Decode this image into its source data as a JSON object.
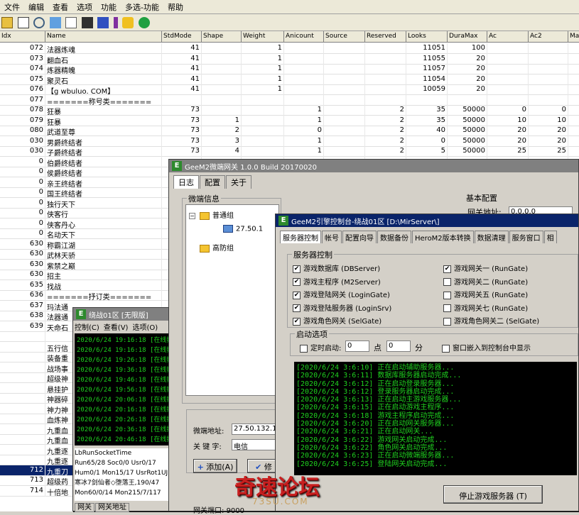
{
  "menubar": [
    "文件",
    "编辑",
    "查看",
    "选项",
    "功能",
    "多选-功能",
    "帮助"
  ],
  "grid": {
    "columns": [
      "Idx",
      "Name",
      "StdMode",
      "Shape",
      "Weight",
      "Anicount",
      "Source",
      "Reserved",
      "Looks",
      "DuraMax",
      "Ac",
      "Ac2",
      "Ma"
    ],
    "rows": [
      [
        "072",
        "法器炼魂",
        "41",
        "",
        "1",
        "",
        "",
        "",
        "11051",
        "100",
        "",
        "",
        ""
      ],
      [
        "073",
        "翻血石",
        "41",
        "",
        "1",
        "",
        "",
        "",
        "11055",
        "20",
        "",
        "",
        ""
      ],
      [
        "074",
        "炼器精魄",
        "41",
        "",
        "1",
        "",
        "",
        "",
        "11057",
        "20",
        "",
        "",
        ""
      ],
      [
        "075",
        "聚灵石",
        "41",
        "",
        "1",
        "",
        "",
        "",
        "11054",
        "20",
        "",
        "",
        ""
      ],
      [
        "076",
        "【g wbuluo. COM】",
        "41",
        "",
        "1",
        "",
        "",
        "",
        "10059",
        "20",
        "",
        "",
        ""
      ],
      [
        "077",
        "=======称号类=======",
        "",
        "",
        "",
        "",
        "",
        "",
        "",
        "",
        "",
        "",
        ""
      ],
      [
        "078",
        "狂暴",
        "73",
        "",
        "",
        "1",
        "",
        "2",
        "35",
        "50000",
        "0",
        "0",
        ""
      ],
      [
        "079",
        "狂暴",
        "73",
        "1",
        "",
        "1",
        "",
        "2",
        "35",
        "50000",
        "10",
        "10",
        ""
      ],
      [
        "080",
        "武道至尊",
        "73",
        "2",
        "",
        "0",
        "",
        "2",
        "40",
        "50000",
        "20",
        "20",
        ""
      ],
      [
        "030",
        "男爵终结者",
        "73",
        "3",
        "",
        "1",
        "",
        "2",
        "0",
        "50000",
        "20",
        "20",
        ""
      ],
      [
        "030",
        "子爵终结者",
        "73",
        "4",
        "",
        "1",
        "",
        "2",
        "5",
        "50000",
        "25",
        "25",
        ""
      ],
      [
        "0",
        "伯爵终结者",
        "",
        "",
        "",
        "",
        "",
        "",
        "",
        "",
        "",
        "",
        ""
      ],
      [
        "0",
        "侯爵终结者",
        "",
        "",
        "",
        "",
        "",
        "",
        "",
        "",
        "",
        "",
        ""
      ],
      [
        "0",
        "亲王终结者",
        "",
        "",
        "",
        "",
        "",
        "",
        "",
        "",
        "",
        "",
        ""
      ],
      [
        "0",
        "国王终结者",
        "",
        "",
        "",
        "",
        "",
        "",
        "",
        "",
        "",
        "",
        ""
      ],
      [
        "0",
        "独行天下",
        "",
        "",
        "",
        "",
        "",
        "",
        "",
        "",
        "",
        "",
        ""
      ],
      [
        "0",
        "侠客行",
        "",
        "",
        "",
        "",
        "",
        "",
        "",
        "",
        "",
        "",
        ""
      ],
      [
        "0",
        "侠客丹心",
        "",
        "",
        "",
        "",
        "",
        "",
        "",
        "",
        "",
        "",
        ""
      ],
      [
        "0",
        "名动天下",
        "",
        "",
        "",
        "",
        "",
        "",
        "",
        "",
        "",
        "",
        ""
      ],
      [
        "630",
        "称霸江湖",
        "",
        "",
        "",
        "",
        "",
        "",
        "",
        "",
        "",
        "",
        ""
      ],
      [
        "630",
        "武林天骄",
        "",
        "",
        "",
        "",
        "",
        "",
        "",
        "",
        "",
        "",
        ""
      ],
      [
        "630",
        "紫禁之巅",
        "",
        "",
        "",
        "",
        "",
        "",
        "",
        "",
        "",
        "",
        ""
      ],
      [
        "630",
        "招主",
        "",
        "",
        "",
        "",
        "",
        "",
        "",
        "",
        "",
        "",
        ""
      ],
      [
        "635",
        "找战",
        "",
        "",
        "",
        "",
        "",
        "",
        "",
        "",
        "",
        "",
        ""
      ],
      [
        "636",
        "=======抒订类=======",
        "",
        "",
        "",
        "",
        "",
        "",
        "",
        "",
        "",
        "",
        ""
      ],
      [
        "637",
        "玛法通",
        "",
        "",
        "",
        "",
        "",
        "",
        "",
        "",
        "",
        "",
        ""
      ],
      [
        "638",
        "法器通",
        "",
        "",
        "",
        "",
        "",
        "",
        "",
        "",
        "",
        "",
        ""
      ],
      [
        "639",
        "天命石",
        "",
        "",
        "",
        "",
        "",
        "",
        "",
        "",
        "",
        "",
        ""
      ],
      [
        "",
        "",
        "",
        "",
        "",
        "",
        "",
        "",
        "",
        "",
        "",
        "",
        ""
      ],
      [
        "",
        "五行信",
        "",
        "",
        "",
        "",
        "",
        "",
        "",
        "",
        "",
        "",
        ""
      ],
      [
        "",
        "装备重",
        "",
        "",
        "",
        "",
        "",
        "",
        "",
        "",
        "",
        "",
        ""
      ],
      [
        "",
        "战场事",
        "",
        "",
        "",
        "",
        "",
        "",
        "",
        "",
        "",
        "",
        ""
      ],
      [
        "",
        "超级神",
        "",
        "",
        "",
        "",
        "",
        "",
        "",
        "",
        "",
        "",
        ""
      ],
      [
        "",
        "悬挂护",
        "",
        "",
        "",
        "",
        "",
        "",
        "",
        "",
        "",
        "",
        ""
      ],
      [
        "",
        "神器碎",
        "",
        "",
        "",
        "",
        "",
        "",
        "",
        "",
        "",
        "",
        ""
      ],
      [
        "",
        "神力神",
        "",
        "",
        "",
        "",
        "",
        "",
        "",
        "",
        "",
        "",
        ""
      ],
      [
        "",
        "血炼神",
        "",
        "",
        "",
        "",
        "",
        "",
        "",
        "",
        "",
        "",
        ""
      ],
      [
        "",
        "九重血",
        "",
        "",
        "",
        "",
        "",
        "",
        "",
        "",
        "",
        "",
        ""
      ],
      [
        "",
        "九重血",
        "",
        "",
        "",
        "",
        "",
        "",
        "",
        "",
        "",
        "",
        ""
      ],
      [
        "",
        "九重逐",
        "",
        "",
        "",
        "",
        "",
        "",
        "",
        "",
        "",
        "",
        ""
      ],
      [
        "",
        "九重逐",
        "",
        "",
        "",
        "",
        "",
        "",
        "",
        "",
        "",
        "",
        ""
      ],
      [
        "712",
        "九重刀",
        "",
        "",
        "",
        "",
        "",
        "",
        "",
        "",
        "",
        "",
        ""
      ],
      [
        "713",
        "超级药",
        "",
        "",
        "",
        "",
        "",
        "",
        "",
        "",
        "",
        "",
        ""
      ],
      [
        "714",
        "十倍地",
        "",
        "",
        "",
        "",
        "",
        "",
        "",
        "",
        "",
        "",
        ""
      ]
    ]
  },
  "gateway_window": {
    "title": "GeeM2微端网关 1.0.0 Build 20170020",
    "tabs": [
      "日志",
      "配置",
      "关于"
    ],
    "group_label": "微端信息",
    "tree": [
      {
        "label": "普通组",
        "type": "folder"
      },
      {
        "label": "27.50.1",
        "type": "monitor"
      },
      {
        "label": "高防组",
        "type": "folder"
      }
    ],
    "basic_config": "基本配置",
    "gateway_address_label": "网关地址:",
    "gateway_address_value": "0.0.0.0",
    "micro_address_label": "微端地址:",
    "micro_address_value": "27.50.132.1",
    "keyword_label": "关 键 字:",
    "keyword_value": "电信",
    "add_button": "添加(A)",
    "modify_button": "修",
    "gateway_port_label": "网关端口:",
    "gateway_port_value": "9000"
  },
  "small_window": {
    "title": "绕战01区 [无限版]",
    "menu": [
      "控制(C)",
      "查看(V)",
      "选项(O)"
    ],
    "log": [
      "2020/6/24 19:16:18 [在线数",
      "2020/6/24 19:16:18 [在线数",
      "2020/6/24 19:26:18 [在线数",
      "2020/6/24 19:36:18 [在线数",
      "2020/6/24 19:46:18 [在线数",
      "2020/6/24 19:56:18 [在线数",
      "2020/6/24 20:06:18 [在线数",
      "2020/6/24 20:16:18 [在线数",
      "2020/6/24 20:26:18 [在线数",
      "2020/6/24 20:36:18 [在线数",
      "2020/6/24 20:46:18 [在线数"
    ],
    "status": [
      "LbRunSocketTime",
      "Run65/28 Soc0/0 Usr0/17",
      "Hum0/1 Mon15/17 UsrRot1UJ",
      "寒冰7剑仙者◇堕落王,190/47",
      "Mon60/0/14 Mon215/7/117"
    ],
    "bottom_tabs": [
      "网关",
      "网关地址"
    ]
  },
  "console_window": {
    "title": "GeeM2引擎控制台-绕战01区 [D:\\MirServer\\]",
    "tabs": [
      "服务器控制",
      "帐号",
      "配置向导",
      "数据备份",
      "HeroM2版本转换",
      "数据清理",
      "服务窗口",
      "相"
    ],
    "server_group_label": "服务器控制",
    "left_checks": [
      {
        "label": "游戏数据库 (DBServer)",
        "checked": true
      },
      {
        "label": "游戏主程序 (M2Server)",
        "checked": true
      },
      {
        "label": "游戏登陆网关 (LoginGate)",
        "checked": true
      },
      {
        "label": "游戏登陆服务器 (LoginSrv)",
        "checked": true
      },
      {
        "label": "游戏角色网关 (SelGate)",
        "checked": true
      }
    ],
    "right_checks": [
      {
        "label": "游戏网关一 (RunGate)",
        "checked": true
      },
      {
        "label": "游戏网关二 (RunGate)",
        "checked": false
      },
      {
        "label": "游戏网关五 (RunGate)",
        "checked": false
      },
      {
        "label": "游戏网关七 (RunGate)",
        "checked": false
      },
      {
        "label": "游戏角色网关二 (SelGate)",
        "checked": false
      }
    ],
    "startup_group_label": "启动选项",
    "timer_label": "定时启动:",
    "hour_value": "0",
    "point_label": "点",
    "minute_value": "0",
    "minute_label": "分",
    "embed_label": "窗口嵌入到控制台中显示",
    "log": [
      "[2020/6/24 3:6:10] 正在启动辅助服务器...",
      "[2020/6/24 3:6:11] 数据库服务器启动完成...",
      "[2020/6/24 3:6:12] 正在启动登录服务器...",
      "[2020/6/24 3:6:12] 登录服务器启动完成...",
      "[2020/6/24 3:6:13] 正在启动主游戏服务器...",
      "[2020/6/24 3:6:15] 正在启动游戏主程序...",
      "[2020/6/24 3:6:18] 游戏主程序启动完成...",
      "[2020/6/24 3:6:20] 正在启动网关服务器...",
      "[2020/6/24 3:6:21] 正在启动网关...",
      "[2020/6/24 3:6:22] 游戏网关启动完成...",
      "[2020/6/24 3:6:22] 角色网关启动完成...",
      "[2020/6/24 3:6:23] 正在启动微端服务器...",
      "[2020/6/24 3:6:25] 登陆网关启动完成..."
    ],
    "stop_button": "停止游戏服务器 (T)"
  },
  "watermark": {
    "big": "奇速论坛",
    "small": "73SU.COM"
  }
}
